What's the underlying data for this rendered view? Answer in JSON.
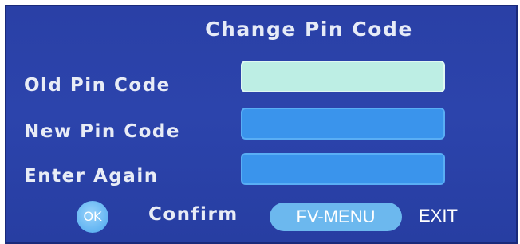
{
  "dialog": {
    "title": "Change Pin Code",
    "fields": [
      {
        "label": "Old Pin Code",
        "value": "",
        "state": "focused"
      },
      {
        "label": "New Pin Code",
        "value": "",
        "state": "normal"
      },
      {
        "label": "Enter Again",
        "value": "",
        "state": "normal"
      }
    ]
  },
  "footer": {
    "ok_label": "OK",
    "confirm_label": "Confirm",
    "menu_label": "FV-MENU",
    "exit_label": "EXIT"
  },
  "colors": {
    "background": "#2a40a6",
    "focused_field": "#bdeee4",
    "normal_field": "#3a94ec",
    "button": "#6cb8ee"
  }
}
